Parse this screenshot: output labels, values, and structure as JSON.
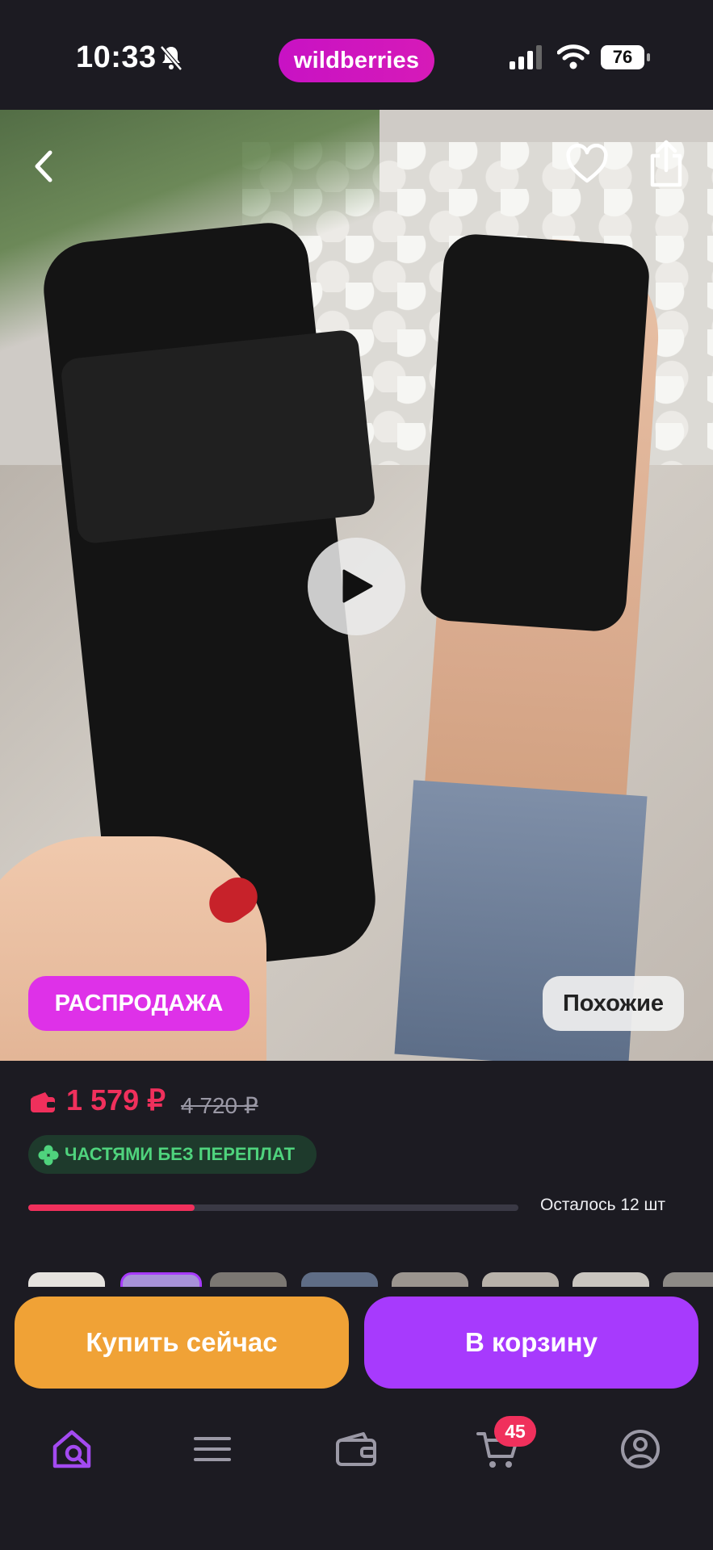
{
  "status_bar": {
    "time": "10:33",
    "brand": "wildberries",
    "battery": "76"
  },
  "product": {
    "sale_badge": "РАСПРОДАЖА",
    "similar_label": "Похожие",
    "price": "1 579 ₽",
    "old_price": "4 720 ₽",
    "installment_label": "ЧАСТЯМИ БЕЗ ПЕРЕПЛАТ",
    "stock_label": "Осталось 12 шт",
    "stock_fraction": 0.34
  },
  "actions": {
    "buy_now": "Купить сейчас",
    "add_to_cart": "В корзину"
  },
  "tabbar": {
    "items": [
      {
        "name": "home-search-icon",
        "active": true
      },
      {
        "name": "catalog-icon",
        "active": false
      },
      {
        "name": "wallet-icon",
        "active": false
      },
      {
        "name": "cart-icon",
        "active": false
      },
      {
        "name": "profile-icon",
        "active": false
      }
    ],
    "cart_count": "45"
  },
  "colors": {
    "accent": "#a73afd",
    "brand": "#cb11ab",
    "price": "#f0305c",
    "buy_now": "#f0a236"
  }
}
